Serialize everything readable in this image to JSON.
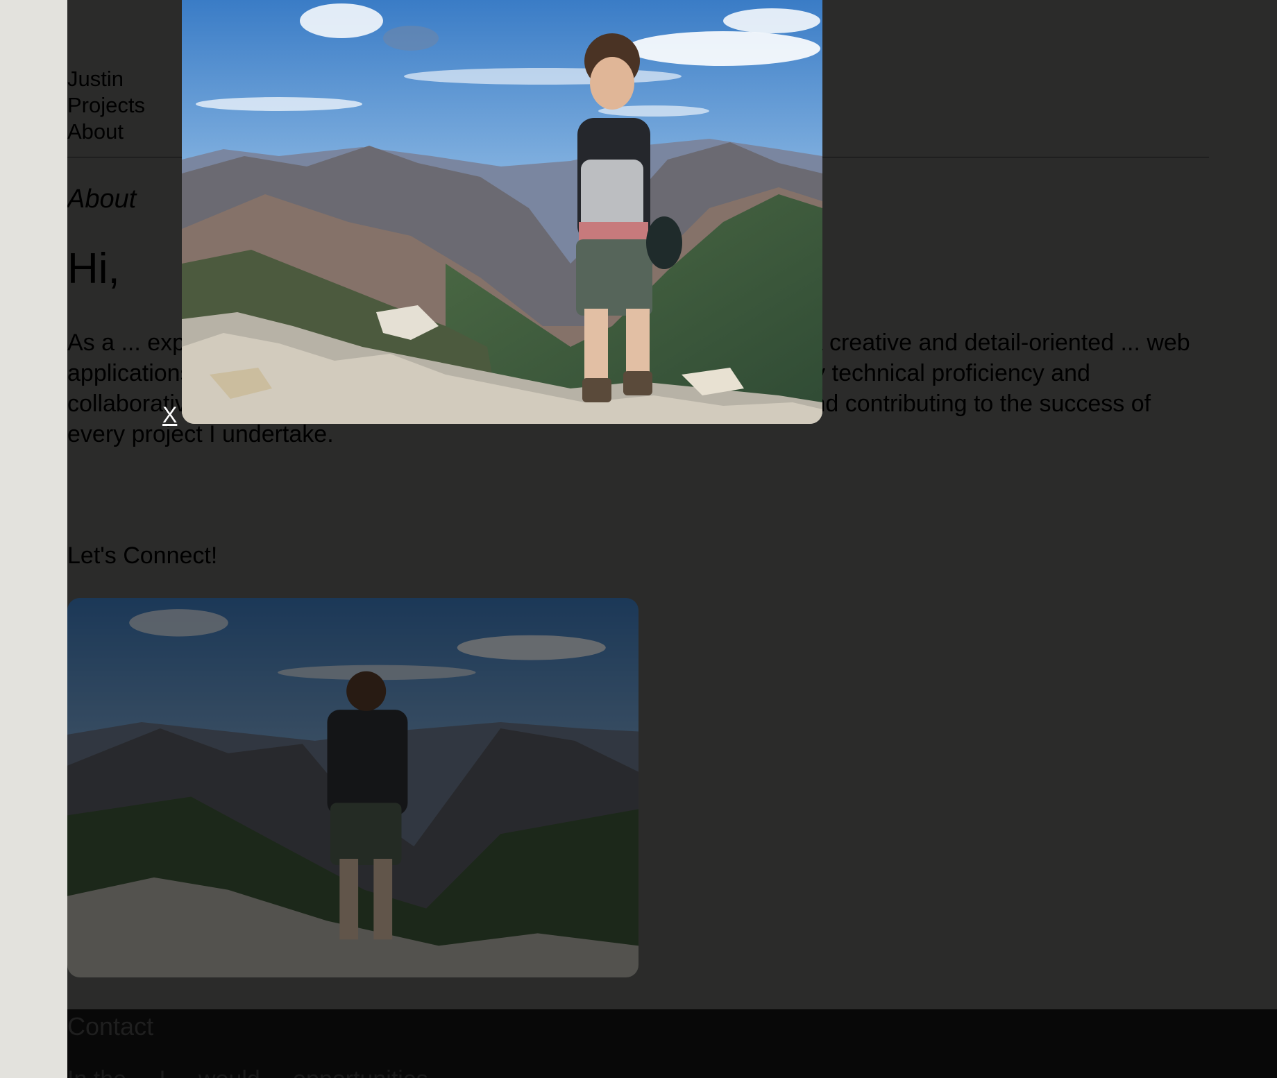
{
  "nav": {
    "name": "Justin",
    "projects": "Projects",
    "about": "About"
  },
  "section_label": "About",
  "greeting": "Hi,",
  "bio": "As a ... experiences, combining my background as a ... expertise. With a creative and detail-oriented ... web applications. By merging my track record of top-tier performance with my technical proficiency and collaborative mindset, I am dedicated to delivering exceptional results and contributing to the success of every project I undertake.",
  "connect": "Let's Connect!",
  "modal": {
    "close_label": "X"
  },
  "footer": {
    "title": "Contact",
    "text": "In the ... I ... would ... opportunities ..."
  },
  "colors": {
    "page_bg": "#2b2b2a",
    "margin_bg": "#e3e2dd",
    "footer_bg": "#080808"
  }
}
